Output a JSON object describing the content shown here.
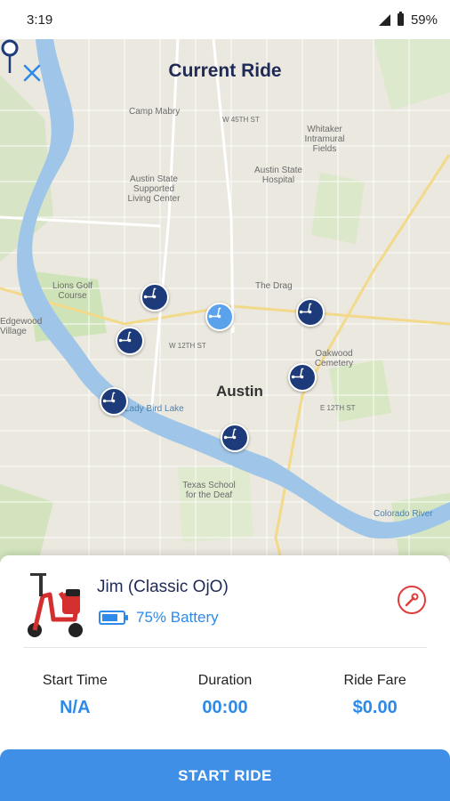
{
  "status_bar": {
    "time": "3:19",
    "battery_percent": "59%"
  },
  "header": {
    "title": "Current Ride",
    "close_icon": "close-icon"
  },
  "map": {
    "city_label": "Austin",
    "labels": [
      "Camp Mabry",
      "W 45TH ST",
      "Whitaker Intramural Fields",
      "Austin State Supported Living Center",
      "Austin State Hospital",
      "Lions Golf Course",
      "Edgewood Village",
      "Oakwood Cemetery",
      "The Drag",
      "Texas School for the Deaf",
      "Colorado River",
      "W 12TH ST",
      "E 12TH ST",
      "Lady Bird Lake"
    ]
  },
  "ride": {
    "vehicle_name": "Jim (Classic OjO)",
    "battery_label": "75% Battery",
    "battery_level": 0.75,
    "stats": [
      {
        "label": "Start Time",
        "value": "N/A"
      },
      {
        "label": "Duration",
        "value": "00:00"
      },
      {
        "label": "Ride Fare",
        "value": "$0.00"
      }
    ]
  },
  "actions": {
    "start_ride": "START RIDE"
  },
  "colors": {
    "accent": "#2d8ae8",
    "title": "#1f2a56",
    "marker": "#1d3b7a",
    "warning": "#e03b3b"
  }
}
